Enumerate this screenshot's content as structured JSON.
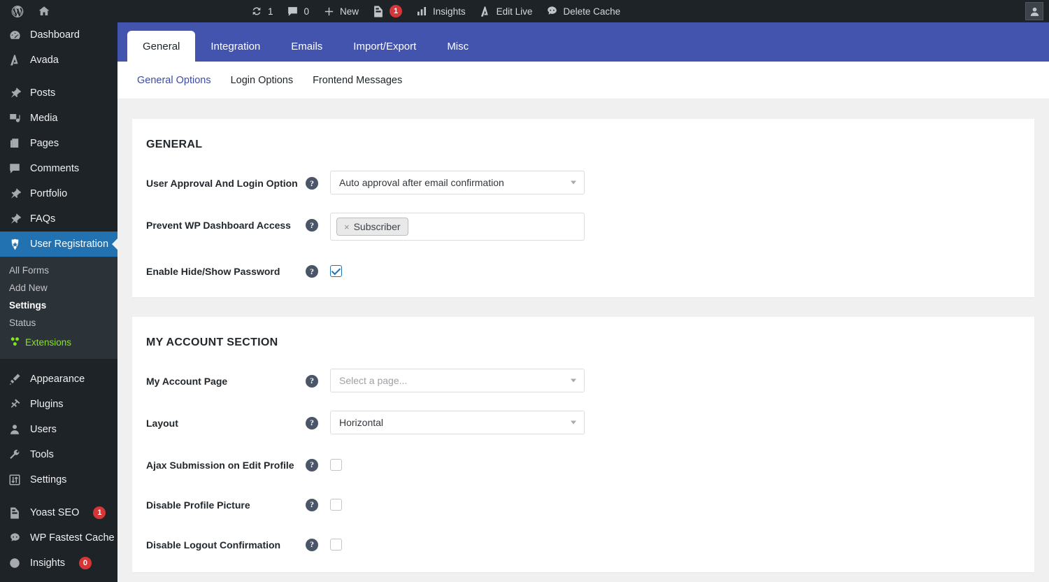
{
  "adminbar": {
    "wp_logo_name": "wordpress-logo-icon",
    "home_name": "home-icon",
    "items": [
      {
        "icon": "refresh-icon",
        "label": "1",
        "name": "updates"
      },
      {
        "icon": "comment-icon",
        "label": "0",
        "name": "comments"
      },
      {
        "icon": "plus-icon",
        "label": "New",
        "name": "new"
      },
      {
        "icon": "yoast-icon",
        "label": "",
        "badge": "1",
        "name": "yoast"
      },
      {
        "icon": "chart-bars-icon",
        "label": "Insights",
        "name": "insights"
      },
      {
        "icon": "avada-icon",
        "label": "Edit Live",
        "name": "edit-live"
      },
      {
        "icon": "cache-icon",
        "label": "Delete Cache",
        "name": "delete-cache"
      }
    ],
    "avatar_name": "user-avatar"
  },
  "sidebar": {
    "items": [
      {
        "label": "Dashboard",
        "icon": "dashboard-icon",
        "type": "item"
      },
      {
        "label": "Avada",
        "icon": "avada-icon",
        "type": "item"
      },
      {
        "type": "separator"
      },
      {
        "label": "Posts",
        "icon": "pin-icon",
        "type": "item"
      },
      {
        "label": "Media",
        "icon": "media-icon",
        "type": "item"
      },
      {
        "label": "Pages",
        "icon": "pages-icon",
        "type": "item"
      },
      {
        "label": "Comments",
        "icon": "comment-icon",
        "type": "item"
      },
      {
        "label": "Portfolio",
        "icon": "pin-icon",
        "type": "item"
      },
      {
        "label": "FAQs",
        "icon": "pin-icon",
        "type": "item"
      },
      {
        "label": "User Registration",
        "icon": "user-registration-icon",
        "type": "item",
        "active": true
      }
    ],
    "submenu": [
      {
        "label": "All Forms"
      },
      {
        "label": "Add New"
      },
      {
        "label": "Settings",
        "current": true
      },
      {
        "label": "Status"
      },
      {
        "label": "Extensions",
        "green": true,
        "icon": "hexagons-icon"
      }
    ],
    "items_bottom": [
      {
        "label": "Appearance",
        "icon": "brush-icon",
        "type": "item"
      },
      {
        "label": "Plugins",
        "icon": "plug-icon",
        "type": "item"
      },
      {
        "label": "Users",
        "icon": "user-icon",
        "type": "item"
      },
      {
        "label": "Tools",
        "icon": "wrench-icon",
        "type": "item"
      },
      {
        "label": "Settings",
        "icon": "settings-icon",
        "type": "item"
      },
      {
        "type": "separator"
      },
      {
        "label": "Yoast SEO",
        "icon": "yoast-icon",
        "type": "item",
        "badge": "1"
      },
      {
        "label": "WP Fastest Cache",
        "icon": "cache-icon",
        "type": "item"
      },
      {
        "label": "Insights",
        "icon": "insights-icon",
        "type": "item",
        "badge": "0"
      }
    ]
  },
  "tabs": [
    {
      "label": "General",
      "active": true
    },
    {
      "label": "Integration"
    },
    {
      "label": "Emails"
    },
    {
      "label": "Import/Export"
    },
    {
      "label": "Misc"
    }
  ],
  "subtabs": [
    {
      "label": "General Options",
      "active": true
    },
    {
      "label": "Login Options"
    },
    {
      "label": "Frontend Messages"
    }
  ],
  "panels": [
    {
      "title": "GENERAL",
      "fields": [
        {
          "label": "User Approval And Login Option",
          "type": "select",
          "value": "Auto approval after email confirmation",
          "name": "user-approval-login-option"
        },
        {
          "label": "Prevent WP Dashboard Access",
          "type": "tags",
          "tags": [
            {
              "label": "Subscriber",
              "remove": "×"
            }
          ],
          "name": "prevent-wp-dashboard-access"
        },
        {
          "label": "Enable Hide/Show Password",
          "type": "checkbox",
          "checked": true,
          "name": "enable-hide-show-password"
        }
      ]
    },
    {
      "title": "MY ACCOUNT SECTION",
      "fields": [
        {
          "label": "My Account Page",
          "type": "select",
          "value": "Select a page...",
          "placeholder": true,
          "name": "my-account-page"
        },
        {
          "label": "Layout",
          "type": "select",
          "value": "Horizontal",
          "name": "layout"
        },
        {
          "label": "Ajax Submission on Edit Profile",
          "type": "checkbox",
          "checked": false,
          "name": "ajax-submission-edit-profile"
        },
        {
          "label": "Disable Profile Picture",
          "type": "checkbox",
          "checked": false,
          "name": "disable-profile-picture"
        },
        {
          "label": "Disable Logout Confirmation",
          "type": "checkbox",
          "checked": false,
          "name": "disable-logout-confirmation"
        }
      ]
    }
  ],
  "help_glyph": "?",
  "colors": {
    "adminbar": "#1d2327",
    "sidebar": "#1d2327",
    "sidebar_active": "#2271b1",
    "tabbar": "#4254ad",
    "accent_link": "#3c4ba6",
    "badge_red": "#d63638",
    "extensions_green": "#83e71b",
    "page_bg": "#f0f0f1"
  }
}
